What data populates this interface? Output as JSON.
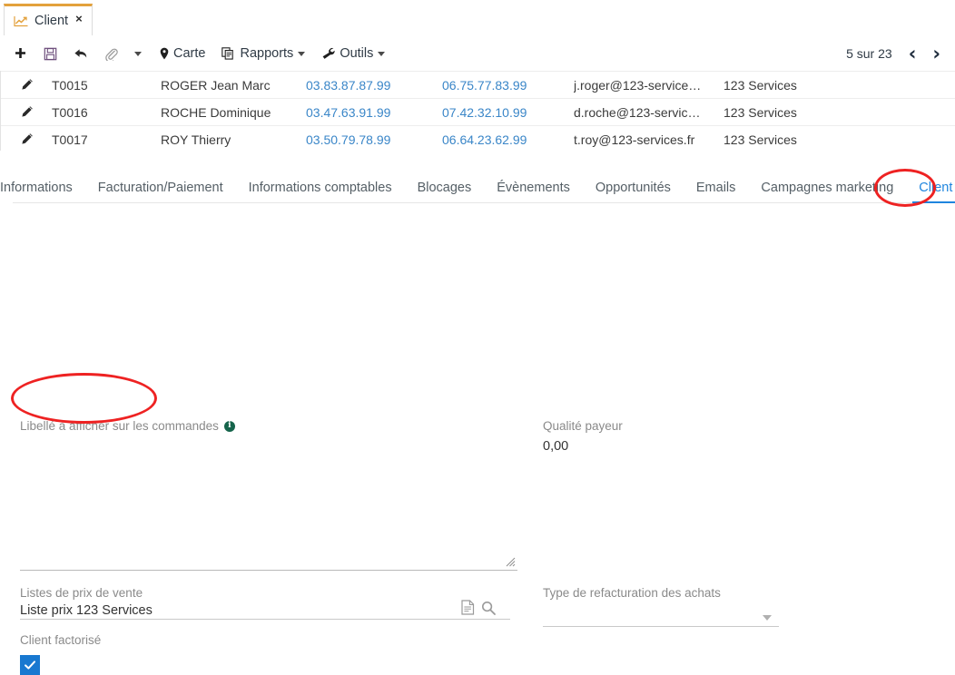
{
  "window": {
    "tab": {
      "label": "Client",
      "icon": "chart-line-icon",
      "close": "×"
    }
  },
  "toolbar": {
    "buttons": [
      {
        "name": "new",
        "icon": "plus-icon",
        "label": ""
      },
      {
        "name": "save",
        "icon": "floppy-disk-icon",
        "label": ""
      },
      {
        "name": "undo",
        "icon": "undo-arrow-icon",
        "label": ""
      },
      {
        "name": "attachment",
        "icon": "paperclip-icon",
        "label": ""
      },
      {
        "name": "more",
        "icon": "chevron-down-icon",
        "label": ""
      }
    ],
    "carte": "Carte",
    "rapports": "Rapports",
    "outils": "Outils",
    "pager": {
      "text": "5 sur 23",
      "prev": "‹",
      "next": "›"
    }
  },
  "grid": {
    "rows": [
      {
        "code": "T0015",
        "name": "ROGER Jean Marc",
        "tel1": "03.83.87.87.99",
        "tel2": "06.75.77.83.99",
        "email": "j.roger@123-service…",
        "company": "123 Services"
      },
      {
        "code": "T0016",
        "name": "ROCHE Dominique",
        "tel1": "03.47.63.91.99",
        "tel2": "07.42.32.10.99",
        "email": "d.roche@123-servic…",
        "company": "123 Services"
      },
      {
        "code": "T0017",
        "name": "ROY Thierry",
        "tel1": "03.50.79.78.99",
        "tel2": "06.64.23.62.99",
        "email": "t.roy@123-services.fr",
        "company": "123 Services"
      }
    ]
  },
  "inner_tabs": {
    "items": [
      {
        "label": "Informations",
        "active": false
      },
      {
        "label": "Facturation/Paiement",
        "active": false
      },
      {
        "label": "Informations comptables",
        "active": false
      },
      {
        "label": "Blocages",
        "active": false
      },
      {
        "label": "Évènements",
        "active": false
      },
      {
        "label": "Opportunités",
        "active": false
      },
      {
        "label": "Emails",
        "active": false
      },
      {
        "label": "Campagnes marketing",
        "active": false
      },
      {
        "label": "Client",
        "active": true
      }
    ]
  },
  "form": {
    "libelle_commandes": {
      "label": "Libellé à afficher sur les commandes",
      "info": "i",
      "value": ""
    },
    "qualite_payeur": {
      "label": "Qualité payeur",
      "value": "0,00"
    },
    "listes_prix": {
      "label": "Listes de prix de vente",
      "value": "Liste prix 123 Services"
    },
    "type_refacturation": {
      "label": "Type de refacturation des achats",
      "value": ""
    },
    "client_factorise": {
      "label": "Client factorisé",
      "checked": true
    }
  },
  "colors": {
    "tab_accent": "#e3a13c",
    "active_tab": "#1f85de",
    "link": "#3a86c8",
    "checkbox": "#1878d0",
    "annotation": "#ee2222",
    "info_badge": "#15644b"
  }
}
